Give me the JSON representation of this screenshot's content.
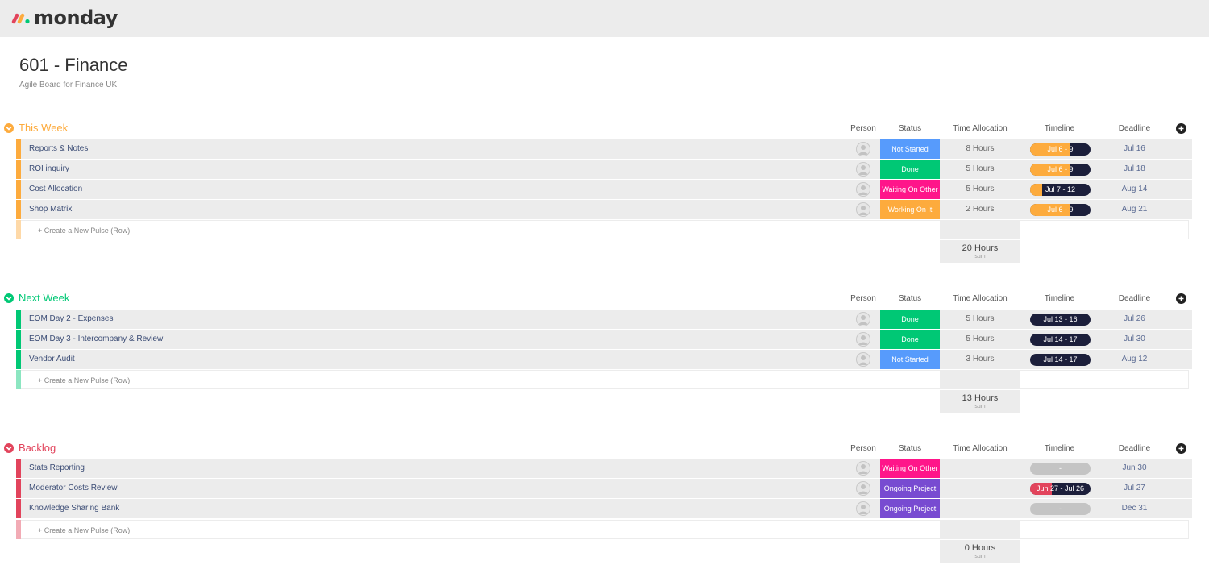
{
  "app": {
    "logo_text": "monday"
  },
  "board": {
    "title": "601 - Finance",
    "description": "Agile Board for Finance UK"
  },
  "colors": {
    "this_week": "#fdab3d",
    "next_week": "#00c875",
    "backlog": "#e2445c",
    "not_started": "#579bfc",
    "done": "#00c875",
    "waiting": "#ff158a",
    "working": "#fdab3d",
    "ongoing": "#784bd1",
    "timeline_dark": "#1c1f3b",
    "timeline_empty": "#c4c4c4"
  },
  "columns": {
    "person": "Person",
    "status": "Status",
    "time": "Time Allocation",
    "timeline": "Timeline",
    "deadline": "Deadline"
  },
  "groups": [
    {
      "name": "This Week",
      "new_row": "+ Create a New Pulse (Row)",
      "sum": {
        "value": "20 Hours",
        "label": "sum"
      },
      "rows": [
        {
          "name": "Reports & Notes",
          "status": "Not Started",
          "time": "8 Hours",
          "timeline": "Jul 6 - 9",
          "timeline_progress": 0.66,
          "deadline": "Jul 16"
        },
        {
          "name": "ROI inquiry",
          "status": "Done",
          "time": "5 Hours",
          "timeline": "Jul 6 - 9",
          "timeline_progress": 0.66,
          "deadline": "Jul 18"
        },
        {
          "name": "Cost Allocation",
          "status": "Waiting On Other",
          "time": "5 Hours",
          "timeline": "Jul 7 - 12",
          "timeline_progress": 0.2,
          "deadline": "Aug 14"
        },
        {
          "name": "Shop Matrix",
          "status": "Working On It",
          "time": "2 Hours",
          "timeline": "Jul 6 - 9",
          "timeline_progress": 0.66,
          "deadline": "Aug 21"
        }
      ]
    },
    {
      "name": "Next Week",
      "new_row": "+ Create a New Pulse (Row)",
      "sum": {
        "value": "13 Hours",
        "label": "sum"
      },
      "rows": [
        {
          "name": "EOM Day 2 - Expenses",
          "status": "Done",
          "time": "5 Hours",
          "timeline": "Jul 13 - 16",
          "timeline_progress": 0,
          "deadline": "Jul 26"
        },
        {
          "name": "EOM Day 3 - Intercompany & Review",
          "status": "Done",
          "time": "5 Hours",
          "timeline": "Jul 14 - 17",
          "timeline_progress": 0,
          "deadline": "Jul 30"
        },
        {
          "name": "Vendor Audit",
          "status": "Not Started",
          "time": "3 Hours",
          "timeline": "Jul 14 - 17",
          "timeline_progress": 0,
          "deadline": "Aug 12"
        }
      ]
    },
    {
      "name": "Backlog",
      "new_row": "+ Create a New Pulse (Row)",
      "sum": {
        "value": "0 Hours",
        "label": "sum"
      },
      "rows": [
        {
          "name": "Stats Reporting",
          "status": "Waiting On Other",
          "time": "",
          "timeline": "-",
          "timeline_progress": -1,
          "deadline": "Jun 30"
        },
        {
          "name": "Moderator Costs Review",
          "status": "Ongoing Project",
          "time": "",
          "timeline": "Jun 27 - Jul 26",
          "timeline_progress": 0.36,
          "deadline": "Jul 27"
        },
        {
          "name": "Knowledge Sharing Bank",
          "status": "Ongoing Project",
          "time": "",
          "timeline": "-",
          "timeline_progress": -1,
          "deadline": "Dec 31"
        }
      ]
    }
  ]
}
